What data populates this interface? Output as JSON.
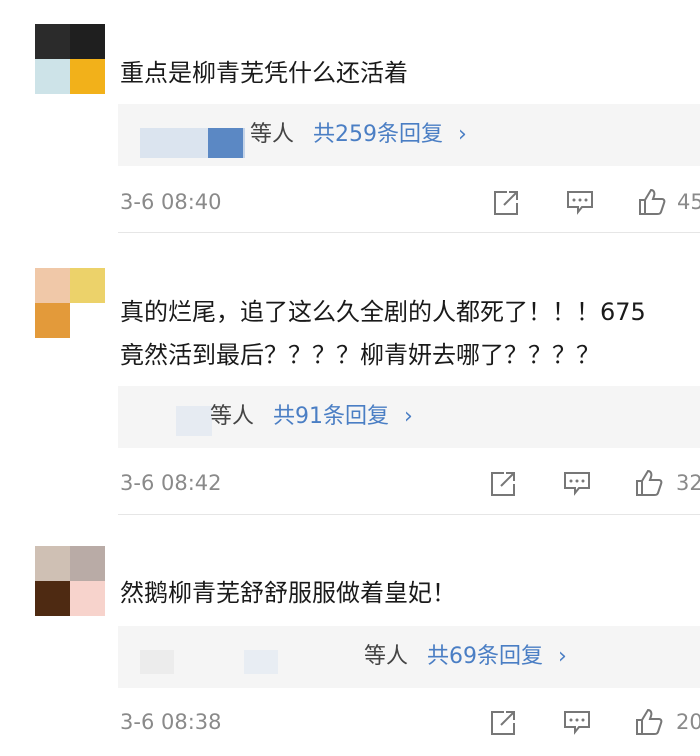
{
  "comments": [
    {
      "text_lines": [
        "重点是柳青芜凭什么还活着"
      ],
      "reply_suffix": "等人",
      "reply_count_label": "共259条回复",
      "time": "3-6 08:40",
      "likes": "45",
      "avatar_colors": [
        "#2b2b2b",
        "#1f1f1f",
        "#cde3e8",
        "#f2b11a"
      ]
    },
    {
      "text_lines": [
        "真的烂尾，追了这么久全剧的人都死了！！！675",
        "竟然活到最后？？？？柳青妍去哪了？？？？"
      ],
      "reply_suffix": "等人",
      "reply_count_label": "共91条回复",
      "time": "3-6 08:42",
      "likes": "32",
      "avatar_colors": [
        "#f0c8a8",
        "#ecd26a",
        "#e39a3a",
        "#ffffff"
      ]
    },
    {
      "text_lines": [
        "然鹅柳青芜舒舒服服做着皇妃！"
      ],
      "reply_suffix": "等人",
      "reply_count_label": "共69条回复",
      "time": "3-6 08:38",
      "likes": "20",
      "avatar_colors": [
        "#cfc0b4",
        "#b9aba6",
        "#4e2a12",
        "#f7d3cc"
      ]
    }
  ],
  "icons": {
    "share": "share-icon",
    "comment": "comment-icon",
    "like": "like-icon",
    "chevron": "chevron-right-icon"
  },
  "colors": {
    "link": "#4a7ec4",
    "meta": "#8a8a8a",
    "reply_bg": "#f5f5f5"
  }
}
